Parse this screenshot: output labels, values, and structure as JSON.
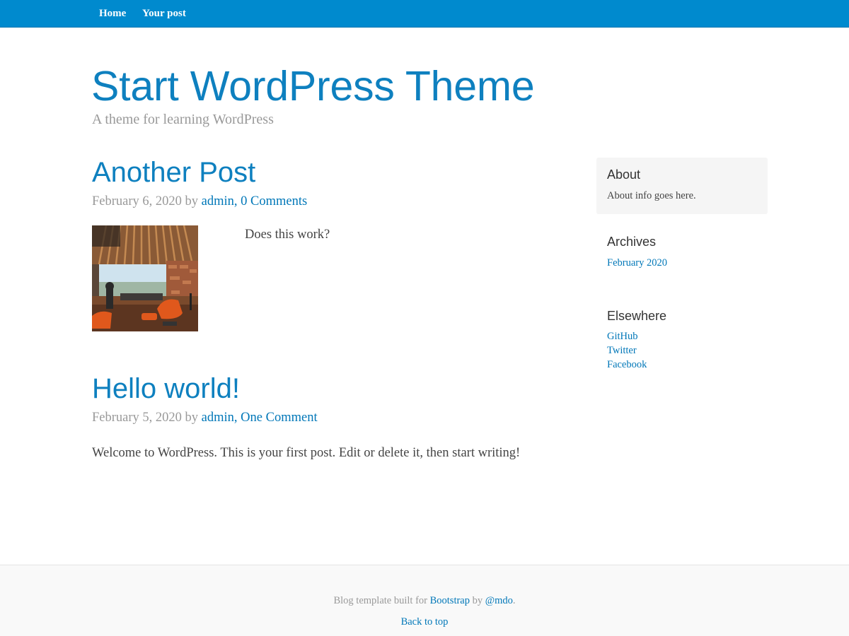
{
  "nav": {
    "items": [
      {
        "label": "Home"
      },
      {
        "label": "Your post"
      }
    ]
  },
  "header": {
    "title": "Start WordPress Theme",
    "description": "A theme for learning WordPress"
  },
  "posts": [
    {
      "title": "Another Post",
      "date": "February 6, 2020",
      "by": "by",
      "author": "admin",
      "comma": ",",
      "comments": "0 Comments",
      "content": "Does this work?",
      "thumbnail_icon": "room-photo-icon"
    },
    {
      "title": "Hello world!",
      "date": "February 5, 2020",
      "by": "by",
      "author": "admin",
      "comma": ",",
      "comments": "One Comment",
      "content": "Welcome to WordPress. This is your first post. Edit or delete it, then start writing!"
    }
  ],
  "sidebar": {
    "about": {
      "title": "About",
      "text": "About info goes here."
    },
    "archives": {
      "title": "Archives",
      "links": [
        "February 2020"
      ]
    },
    "elsewhere": {
      "title": "Elsewhere",
      "links": [
        "GitHub",
        "Twitter",
        "Facebook"
      ]
    }
  },
  "footer": {
    "prefix": "Blog template built for",
    "bootstrap": "Bootstrap",
    "by": "by",
    "mdo": "@mdo",
    "suffix": ".",
    "back_to_top": "Back to top"
  },
  "colors": {
    "nav_bg": "#008ace",
    "link": "#0077b8",
    "title": "#0e80bf",
    "muted": "#999999",
    "widget_bg": "#f5f5f5"
  }
}
